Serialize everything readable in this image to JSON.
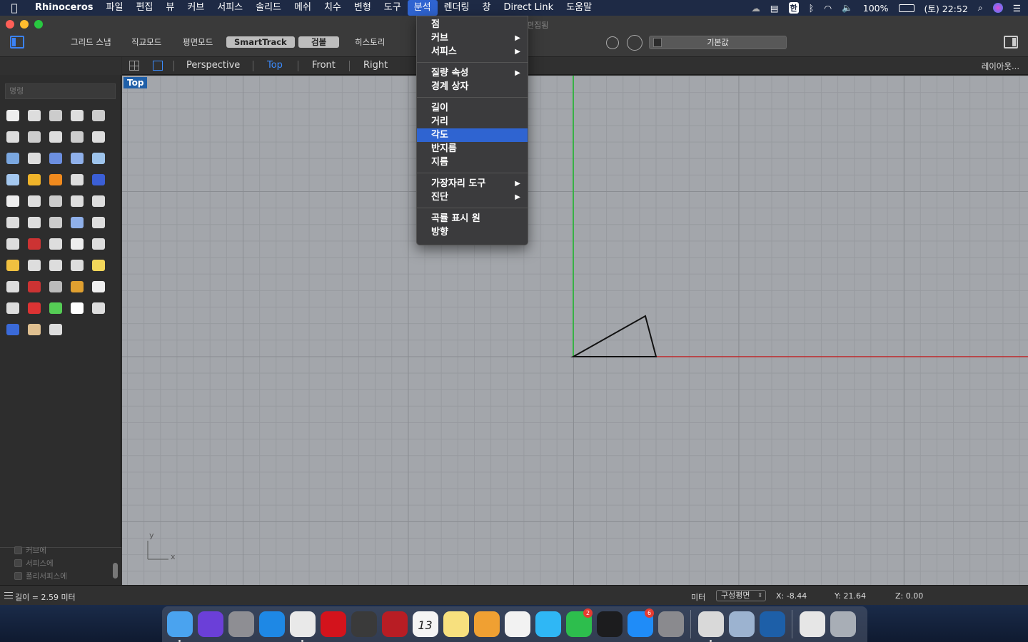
{
  "menubar": {
    "apple": "",
    "items": [
      "Rhinoceros",
      "파일",
      "편집",
      "뷰",
      "커브",
      "서피스",
      "솔리드",
      "메쉬",
      "치수",
      "변형",
      "도구",
      "분석",
      "렌더링",
      "창",
      "Direct Link",
      "도움말"
    ],
    "active_index": 11,
    "battery": "100%",
    "clock": "(토) 22:52",
    "input_method": "한"
  },
  "window": {
    "doc_title": "편집됨",
    "modes": {
      "grid_snap": "그리드 스냅",
      "ortho": "직교모드",
      "planar": "평면모드",
      "smarttrack": "SmartTrack",
      "gumball": "검볼",
      "history": "히스토리"
    },
    "layer": "기본값"
  },
  "viewport_tabs": {
    "tabs": [
      "Perspective",
      "Top",
      "Front",
      "Right"
    ],
    "active": "Top",
    "layout_button": "레이아웃..."
  },
  "command": {
    "placeholder": "명령"
  },
  "filters": [
    "커브에",
    "서피스에",
    "폴리서피스에"
  ],
  "viewport": {
    "label": "Top",
    "axis_y": "y",
    "axis_x": "x"
  },
  "dropdown": {
    "groups": [
      [
        {
          "label": "점",
          "sub": false
        },
        {
          "label": "커브",
          "sub": true
        },
        {
          "label": "서피스",
          "sub": true
        }
      ],
      [
        {
          "label": "질량 속성",
          "sub": true
        },
        {
          "label": "경계 상자",
          "sub": false
        }
      ],
      [
        {
          "label": "길이",
          "sub": false
        },
        {
          "label": "거리",
          "sub": false
        },
        {
          "label": "각도",
          "sub": false,
          "highlight": true
        },
        {
          "label": "반지름",
          "sub": false
        },
        {
          "label": "지름",
          "sub": false
        }
      ],
      [
        {
          "label": "가장자리 도구",
          "sub": true
        },
        {
          "label": "진단",
          "sub": true
        }
      ],
      [
        {
          "label": "곡률 표시 원",
          "sub": false
        },
        {
          "label": "방향",
          "sub": false
        }
      ]
    ]
  },
  "statusbar": {
    "message": "길이 = 2.59 미터",
    "units": "미터",
    "cplane": "구성평면",
    "x": "X: -8.44",
    "y": "Y: 21.64",
    "z": "Z: 0.00"
  },
  "dock": {
    "apps": [
      {
        "name": "finder",
        "color": "#4aa3ef",
        "running": true
      },
      {
        "name": "siri",
        "color": "#6b3fd8"
      },
      {
        "name": "launchpad",
        "color": "#8e8e93"
      },
      {
        "name": "safari",
        "color": "#1e88e5"
      },
      {
        "name": "chrome",
        "color": "#e9e9e9",
        "running": true
      },
      {
        "name": "opera",
        "color": "#d3131c"
      },
      {
        "name": "activity-monitor",
        "color": "#3a3a3a"
      },
      {
        "name": "photo-booth",
        "color": "#b81d24"
      },
      {
        "name": "calendar",
        "color": "#f4f4f4",
        "label": "13"
      },
      {
        "name": "notes",
        "color": "#f7e07e"
      },
      {
        "name": "pages",
        "color": "#f0a032"
      },
      {
        "name": "photos",
        "color": "#f2f2f2"
      },
      {
        "name": "messages",
        "color": "#2fb7f5"
      },
      {
        "name": "facetime",
        "color": "#2dbe4d",
        "badge": "2"
      },
      {
        "name": "apple-tv",
        "color": "#1c1c1e"
      },
      {
        "name": "app-store",
        "color": "#1f8cf8",
        "badge": "6"
      },
      {
        "name": "system-preferences",
        "color": "#8a8a8e"
      },
      {
        "name": "rhinoceros",
        "color": "#d9d9d9",
        "running": true,
        "after_sep": true
      },
      {
        "name": "preview",
        "color": "#9cb3d0"
      },
      {
        "name": "quicktime",
        "color": "#1d5fa8"
      },
      {
        "name": "documents",
        "color": "#e6e6e6",
        "after_sep": true
      },
      {
        "name": "trash",
        "color": "#a8aeb6"
      }
    ]
  }
}
